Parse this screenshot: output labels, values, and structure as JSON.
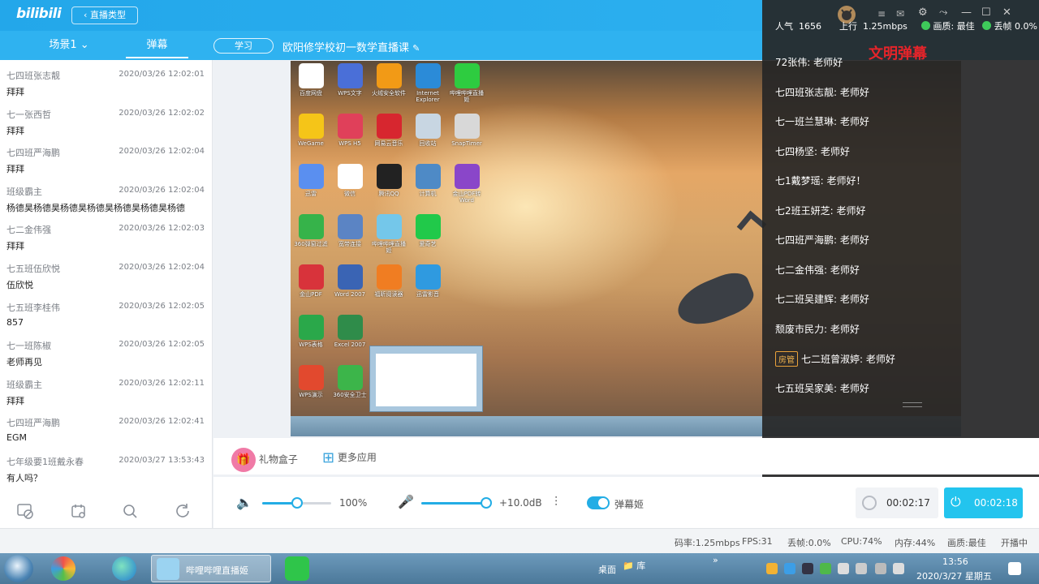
{
  "header": {
    "logo": "bilibili",
    "live_type_button": "直播类型"
  },
  "tabs": {
    "scene": "场景1",
    "danmaku": "弹幕",
    "study_tag": "学习",
    "course_title": "欧阳修学校初一数学直播课"
  },
  "danmaku_list": [
    {
      "name": "七四班张志靓",
      "time": "2020/03/26 12:02:01",
      "text": "拜拜"
    },
    {
      "name": "七一张西哲",
      "time": "2020/03/26 12:02:02",
      "text": "拜拜"
    },
    {
      "name": "七四班严海鹏",
      "time": "2020/03/26 12:02:04",
      "text": "拜拜"
    },
    {
      "name": "班级霸主",
      "time": "2020/03/26 12:02:04",
      "text": "杨德昊杨德昊杨德昊杨德昊杨德昊杨德昊杨德"
    },
    {
      "name": "七二金伟强",
      "time": "2020/03/26 12:02:03",
      "text": "拜拜"
    },
    {
      "name": "七五班伍欣悦",
      "time": "2020/03/26 12:02:04",
      "text": "伍欣悦"
    },
    {
      "name": "七五班李桂伟",
      "time": "2020/03/26 12:02:05",
      "text": "857"
    },
    {
      "name": "七一班陈椒",
      "time": "2020/03/26 12:02:05",
      "text": "老师再见"
    },
    {
      "name": "班级霸主",
      "time": "2020/03/26 12:02:11",
      "text": "拜拜"
    },
    {
      "name": "七四班严海鹏",
      "time": "2020/03/26 12:02:41",
      "text": "EGM"
    },
    {
      "name": "七年级要1班戴永春",
      "time": "2020/03/27 13:53:43",
      "text": "有人吗？"
    }
  ],
  "desktop_icons": [
    {
      "label": "百度网盘",
      "color": "#ffffff"
    },
    {
      "label": "WPS文字",
      "color": "#4a6fd8"
    },
    {
      "label": "火绒安全软件",
      "color": "#f29a16"
    },
    {
      "label": "Internet Explorer",
      "color": "#2b8bd8"
    },
    {
      "label": "哔哩哔哩直播姬",
      "color": "#2ecc40"
    },
    {
      "label": "WeGame",
      "color": "#f5c518"
    },
    {
      "label": "WPS H5",
      "color": "#e0405a"
    },
    {
      "label": "网易云音乐",
      "color": "#d7262f"
    },
    {
      "label": "回收站",
      "color": "#c8d6e2"
    },
    {
      "label": "SnapTimer",
      "color": "#d8d8d8"
    },
    {
      "label": "迅雷",
      "color": "#5a8ff0"
    },
    {
      "label": "微信",
      "color": "#ffffff"
    },
    {
      "label": "腾讯QQ",
      "color": "#222222"
    },
    {
      "label": "计算机",
      "color": "#4e8ac6"
    },
    {
      "label": "金山PDF转Word",
      "color": "#8a46c9"
    },
    {
      "label": "360弹窗过滤",
      "color": "#36b34a"
    },
    {
      "label": "宽带连接",
      "color": "#5b84c4"
    },
    {
      "label": "哔哩哔哩直播姬",
      "color": "#74c7ea"
    },
    {
      "label": "爱奇艺",
      "color": "#21c94a"
    },
    {
      "label": "金山PDF",
      "color": "#d8333b"
    },
    {
      "label": "Word 2007",
      "color": "#3a64b4"
    },
    {
      "label": "福昕阅读器",
      "color": "#f07d22"
    },
    {
      "label": "迅雷影音",
      "color": "#2f9ae0"
    },
    {
      "label": "WPS表格",
      "color": "#2aa84a"
    },
    {
      "label": "Excel 2007",
      "color": "#2f8c4a"
    },
    {
      "label": "WPS演示",
      "color": "#e2492e"
    },
    {
      "label": "360安全卫士",
      "color": "#3cb54a"
    }
  ],
  "overlay": {
    "popularity_label": "人气",
    "popularity_value": "1656",
    "upload_label": "上行",
    "upload_value": "1.25mbps",
    "quality_label": "画质: 最佳",
    "drop_label": "丢帧 0.0%",
    "title": "文明弹幕",
    "messages": [
      {
        "user": "72张伟:",
        "text": "老师好"
      },
      {
        "user": "七四班张志靓:",
        "text": "老师好"
      },
      {
        "user": "七一班兰慧琳:",
        "text": "老师好"
      },
      {
        "user": "七四杨坚:",
        "text": "老师好"
      },
      {
        "user": "七1戴梦瑶:",
        "text": "老师好！"
      },
      {
        "user": "七2班王妍芝:",
        "text": "老师好"
      },
      {
        "user": "七四班严海鹏:",
        "text": "老师好"
      },
      {
        "user": "七二金伟强:",
        "text": "老师好"
      },
      {
        "user": "七二班吴建辉:",
        "text": "老师好"
      },
      {
        "user": "颓废市民力:",
        "text": "老师好"
      },
      {
        "user": "七二班曾淑婷:",
        "text": "老师好",
        "badge": "房管"
      },
      {
        "user": "七五班吴家美:",
        "text": "老师好"
      }
    ]
  },
  "apps": {
    "gift_box": "礼物盒子",
    "more_apps": "更多应用"
  },
  "controls": {
    "volume": 1.0,
    "volume_text": "100%",
    "mic_gain_text": "+10.0dB",
    "mic_level": 1.0,
    "danmaku_ji": "弹幕姬",
    "record_time": "00:02:17",
    "live_time": "00:02:18"
  },
  "status": {
    "bitrate": "码率:1.25mbps",
    "fps": "FPS:31",
    "drop": "丢帧:0.0%",
    "cpu": "CPU:74%",
    "mem": "内存:44%",
    "quality": "画质:最佳",
    "state": "开播中"
  },
  "taskbar": {
    "window_label": "哔哩哔哩直播姬",
    "desktop_label": "桌面",
    "library_label": "库",
    "time": "13:56",
    "date": "2020/3/27 星期五"
  }
}
